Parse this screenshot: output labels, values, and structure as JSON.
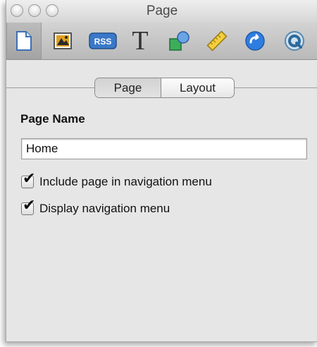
{
  "window": {
    "title": "Page"
  },
  "toolbar": {
    "tools": [
      {
        "name": "page-icon",
        "selected": true
      },
      {
        "name": "photo-icon",
        "selected": false
      },
      {
        "name": "rss-icon",
        "label": "RSS",
        "selected": false
      },
      {
        "name": "text-icon",
        "label": "T",
        "selected": false
      },
      {
        "name": "shapes-icon",
        "selected": false
      },
      {
        "name": "ruler-icon",
        "selected": false
      },
      {
        "name": "link-arrow-icon",
        "selected": false
      },
      {
        "name": "quicktime-icon",
        "selected": false
      }
    ]
  },
  "tabs": {
    "items": [
      "Page",
      "Layout"
    ],
    "active": "Page"
  },
  "page_name": {
    "label": "Page Name",
    "value": "Home"
  },
  "options": {
    "include_in_nav": {
      "label": "Include page in navigation menu",
      "checked": true
    },
    "display_nav": {
      "label": "Display navigation menu",
      "checked": true
    }
  },
  "colors": {
    "panel_bg": "#e6e6e6",
    "toolbar_blue": "#3a78c8"
  }
}
